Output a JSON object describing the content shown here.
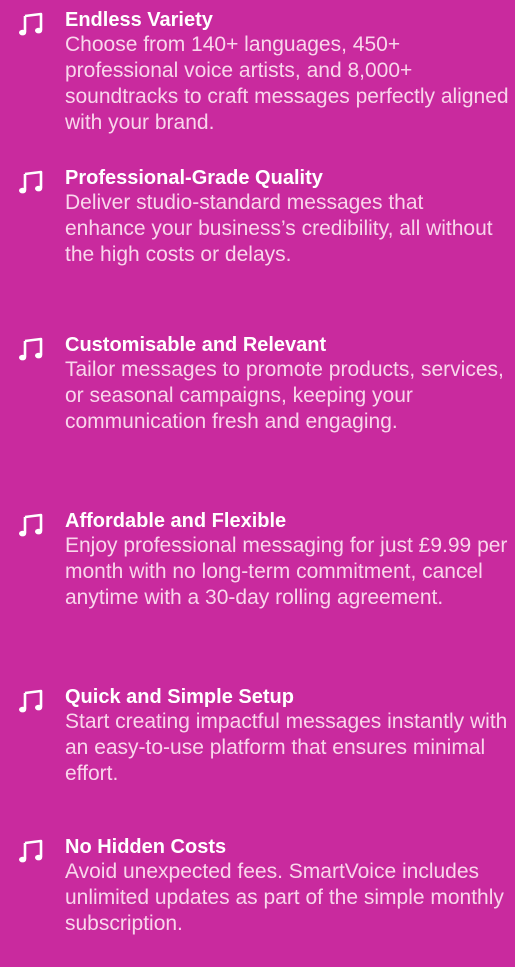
{
  "colors": {
    "background": "#c92a9e",
    "title": "#ffffff",
    "description": "#f9d6ec"
  },
  "icon": "music-note-icon",
  "features": [
    {
      "title": "Endless Variety",
      "description": "Choose from 140+ languages, 450+ professional voice artists, and 8,000+ soundtracks to craft messages perfectly aligned with your brand."
    },
    {
      "title": "Professional-Grade Quality",
      "description": "Deliver studio-standard messages that enhance your business’s credibility, all without the high costs or delays."
    },
    {
      "title": "Customisable and Relevant",
      "description": "Tailor messages to promote products, services, or seasonal campaigns, keeping your communication fresh and engaging."
    },
    {
      "title": "Affordable and Flexible",
      "description": "Enjoy professional messaging for just £9.99 per month with no long-term commitment, cancel anytime with a 30-day rolling agreement."
    },
    {
      "title": "Quick and Simple Setup",
      "description": "Start creating impactful messages instantly with an easy-to-use platform that ensures minimal effort."
    },
    {
      "title": "No Hidden Costs",
      "description": "Avoid unexpected fees. SmartVoice includes unlimited updates as part of the simple monthly subscription."
    }
  ]
}
